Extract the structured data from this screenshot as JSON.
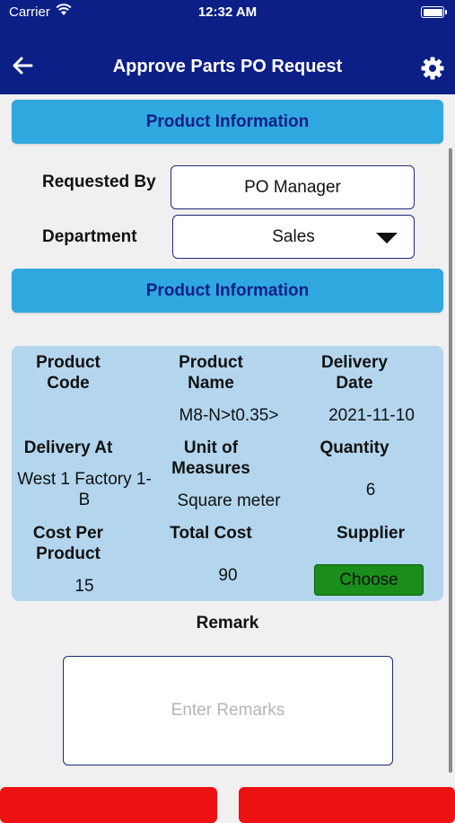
{
  "status_bar": {
    "carrier": "Carrier",
    "time": "12:32 AM"
  },
  "header": {
    "title": "Approve Parts PO Request",
    "back_icon": "arrow-left-icon",
    "settings_icon": "gear-icon"
  },
  "sections": {
    "first_label": "Product Information",
    "second_label": "Product Information"
  },
  "form": {
    "requested_by_label": "Requested By",
    "requested_by_value": "PO Manager",
    "department_label": "Department",
    "department_value": "Sales"
  },
  "product": {
    "product_code_label": "Product\nCode",
    "product_code_value": "",
    "product_name_label": "Product\nName",
    "product_name_value": "M8-N>t0.35>",
    "delivery_date_label": "Delivery\nDate",
    "delivery_date_value": "2021-11-10",
    "delivery_at_label": "Delivery At",
    "delivery_at_value": "West 1 Factory 1-\nB",
    "uom_label": "Unit of\nMeasures",
    "uom_value": "Square meter",
    "quantity_label": "Quantity",
    "quantity_value": "6",
    "cost_per_product_label": "Cost Per\nProduct",
    "cost_per_product_value": "15",
    "total_cost_label": "Total Cost",
    "total_cost_value": "90",
    "supplier_label": "Supplier",
    "supplier_button": "Choose"
  },
  "remark": {
    "label": "Remark",
    "placeholder": "Enter Remarks"
  },
  "colors": {
    "header": "#0c1f87",
    "section": "#2fa8e0",
    "panel": "#b3d6ee",
    "choose": "#1a8d1a",
    "bottom_buttons": "#ee1111"
  }
}
